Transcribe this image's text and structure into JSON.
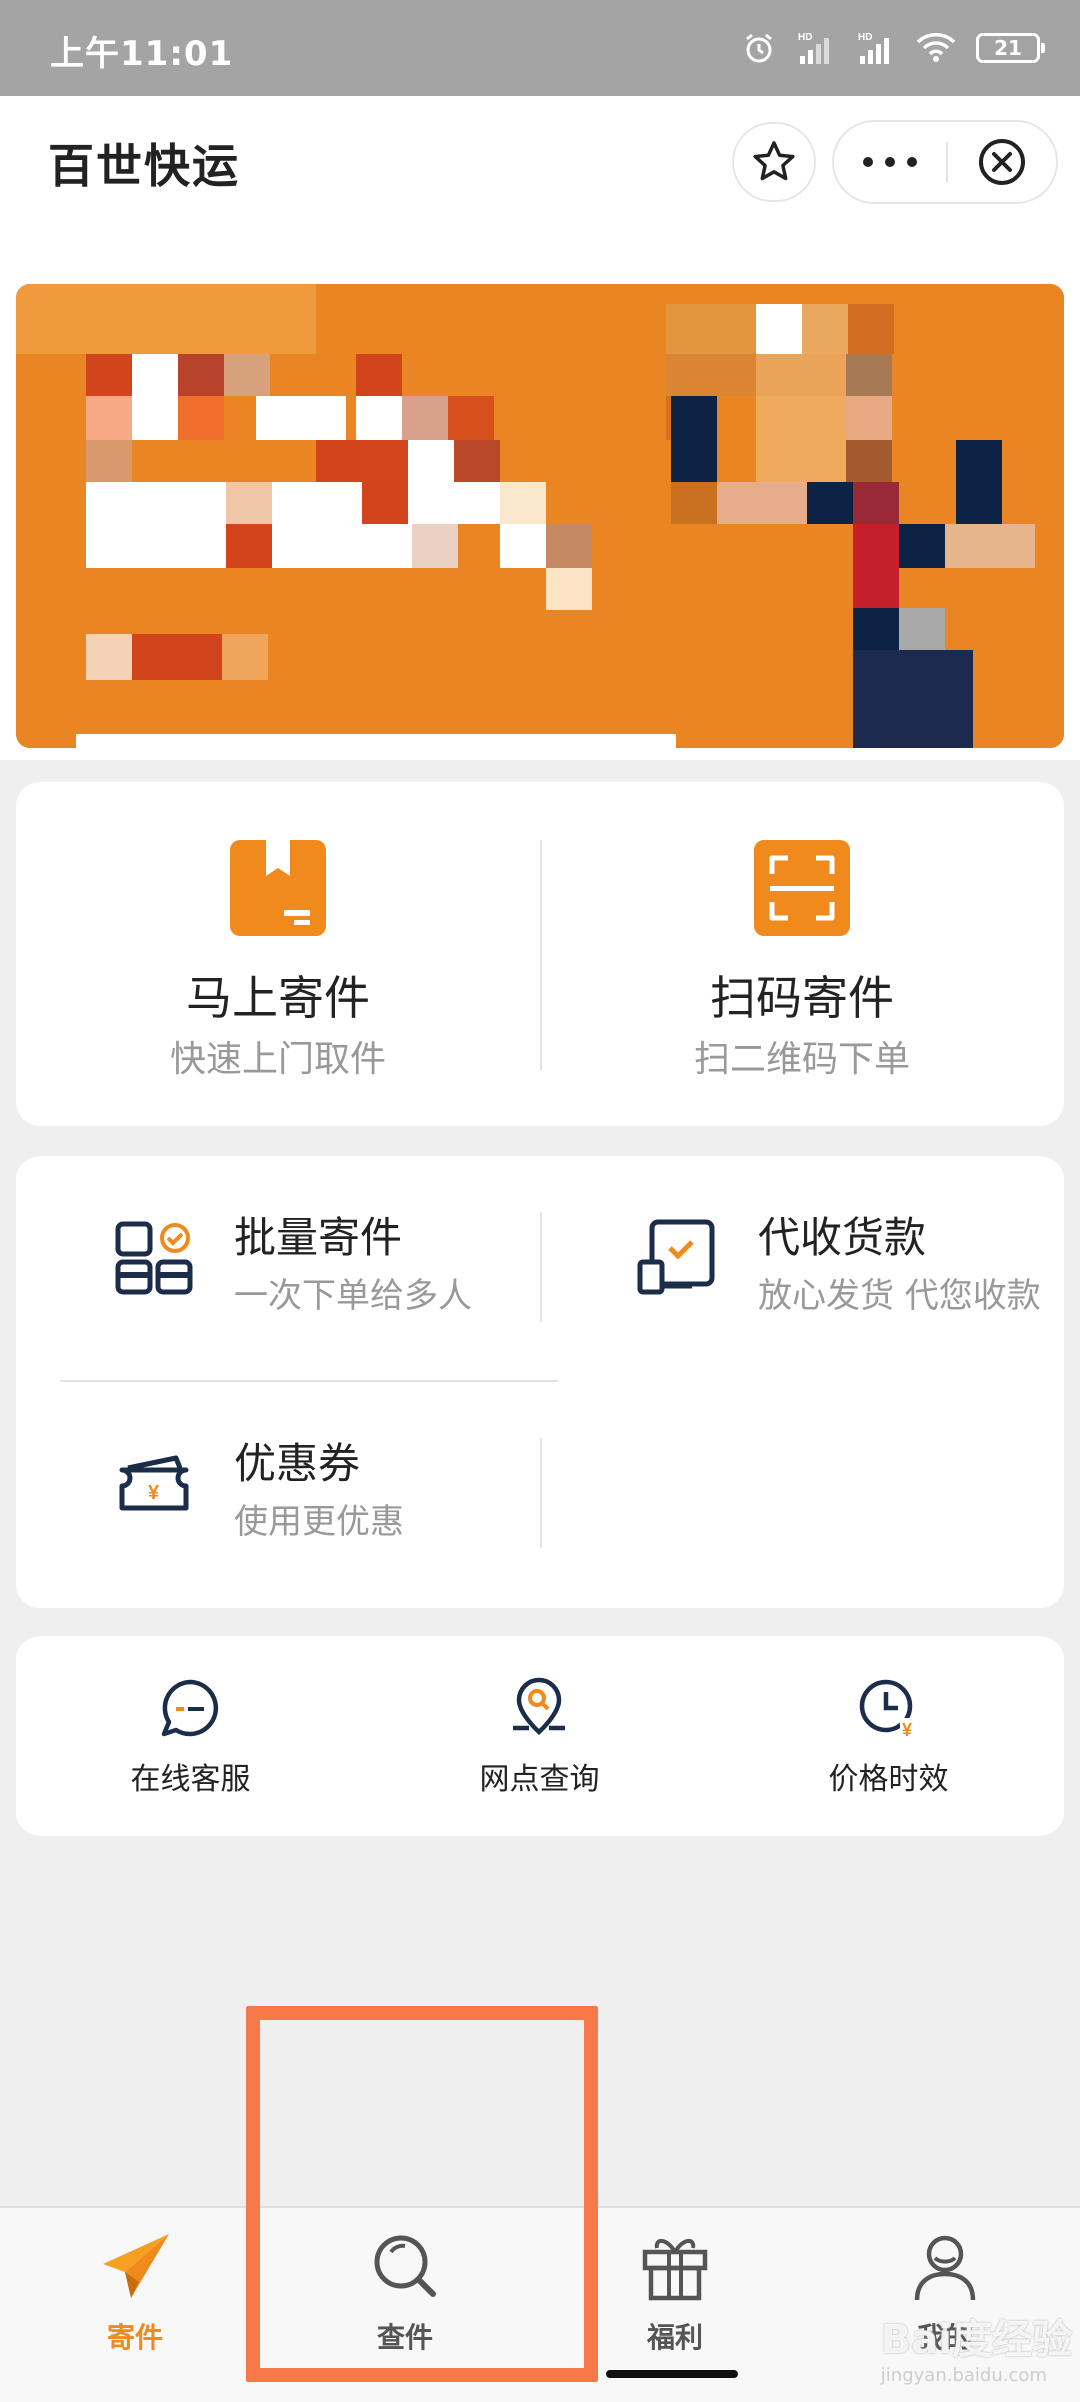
{
  "status_bar": {
    "time": "上午11:01",
    "battery": "21"
  },
  "header": {
    "title": "百世快运"
  },
  "banner": {
    "label": "promo banner (pixelated)"
  },
  "primary_actions": [
    {
      "title": "马上寄件",
      "subtitle": "快速上门取件",
      "icon": "package-icon"
    },
    {
      "title": "扫码寄件",
      "subtitle": "扫二维码下单",
      "icon": "scan-icon"
    }
  ],
  "secondary_actions": [
    {
      "title": "批量寄件",
      "subtitle": "一次下单给多人",
      "icon": "batch-icon"
    },
    {
      "title": "代收货款",
      "subtitle": "放心发货 代您收款",
      "icon": "collect-payment-icon"
    },
    {
      "title": "优惠券",
      "subtitle": "使用更优惠",
      "icon": "coupon-icon"
    }
  ],
  "services": [
    {
      "label": "在线客服",
      "icon": "chat-icon"
    },
    {
      "label": "网点查询",
      "icon": "location-search-icon"
    },
    {
      "label": "价格时效",
      "icon": "clock-price-icon"
    }
  ],
  "tabs": [
    {
      "label": "寄件",
      "icon": "paper-plane-icon",
      "active": true
    },
    {
      "label": "查件",
      "icon": "search-icon",
      "active": false
    },
    {
      "label": "福利",
      "icon": "gift-icon",
      "active": false
    },
    {
      "label": "我的",
      "icon": "user-icon",
      "active": false
    }
  ],
  "watermark": {
    "text": "Bai度经验",
    "url": "jingyan.baidu.com"
  },
  "colors": {
    "accent": "#f08a1c",
    "navy": "#1b2d4a",
    "highlight": "#f7794a"
  }
}
